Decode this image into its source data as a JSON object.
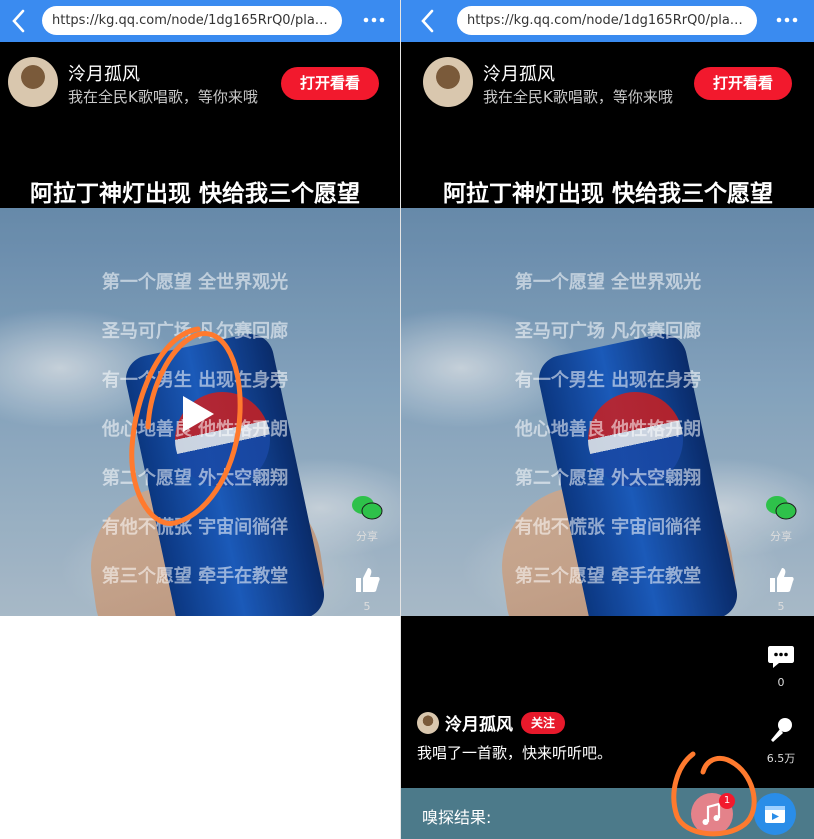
{
  "browser": {
    "url": "https://kg.qq.com/node/1dg165RrQ0/play_v..."
  },
  "header": {
    "username": "泠月孤风",
    "slogan": "我在全民K歌唱歌，等你来哦",
    "open_button": "打开看看"
  },
  "song": {
    "title": "阿拉丁神灯出现 快给我三个愿望",
    "lyrics": [
      "第一个愿望 全世界观光",
      "圣马可广场 凡尔赛回廊",
      "有一个男生 出现在身旁",
      "他心地善良 他性格开朗",
      "第二个愿望 外太空翱翔",
      "有他不慌张 宇宙间徜徉",
      "第三个愿望 牵手在教堂"
    ]
  },
  "actions": {
    "share_label": "分享",
    "like_count": "5",
    "comment_count": "0",
    "sing_count": "6.5万"
  },
  "feed": {
    "username": "泠月孤风",
    "follow_label": "关注",
    "caption": "我唱了一首歌，快来听听吧。"
  },
  "sniff": {
    "label": "嗅探结果:",
    "badge_count": "1"
  },
  "colors": {
    "browser_bar": "#3a8bf0",
    "open_button": "#f2192d",
    "result_bar": "#4c7a8a",
    "annotation": "#ff7a2e"
  },
  "icons": {
    "back": "chevron-left-icon",
    "more": "more-dots-icon",
    "play": "play-icon",
    "share": "wechat-icon",
    "like": "thumbs-up-icon",
    "comment": "comment-icon",
    "sing": "microphone-icon",
    "music": "music-note-icon",
    "video": "video-icon"
  }
}
